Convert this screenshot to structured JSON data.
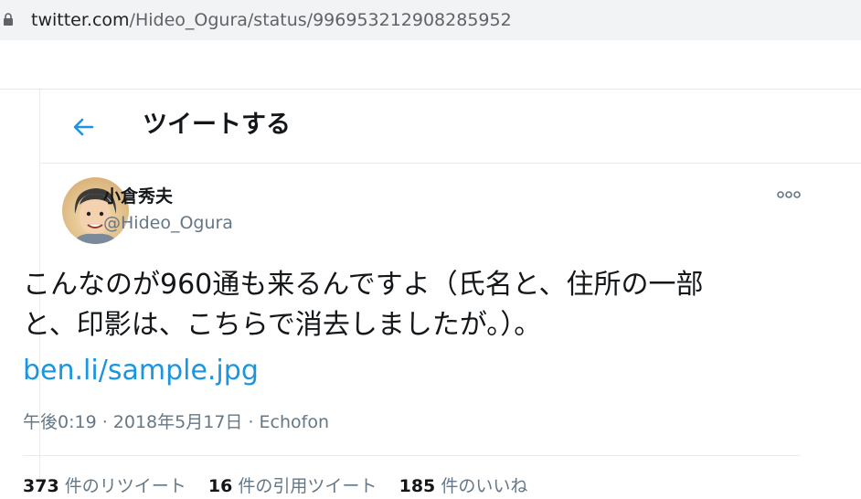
{
  "browser": {
    "lock_icon": "lock-icon",
    "url_domain": "twitter.com",
    "url_path": "/Hideo_Ogura/status/996953212908285952"
  },
  "header": {
    "back_icon": "arrow-left-icon",
    "title": "ツイートする"
  },
  "tweet": {
    "display_name": "小倉秀夫",
    "username": "@Hideo_Ogura",
    "more_icon": "more-icon",
    "text_line1": "こんなのが960通も来るんですよ（氏名と、住所の一部",
    "text_line2": "と、印影は、こちらで消去しましたが。）。",
    "link": "ben.li/sample.jpg",
    "time": "午後0:19",
    "separator1": " · ",
    "date": "2018年5月17日",
    "separator2": " · ",
    "source": "Echofon",
    "stats": [
      {
        "count": "373",
        "label": "件のリツイート"
      },
      {
        "count": "16",
        "label": "件の引用ツイート"
      },
      {
        "count": "185",
        "label": "件のいいね"
      }
    ]
  },
  "colors": {
    "accent": "#1b95e0",
    "text": "#14171a",
    "secondary": "#657786",
    "border": "#e6ecf0"
  }
}
